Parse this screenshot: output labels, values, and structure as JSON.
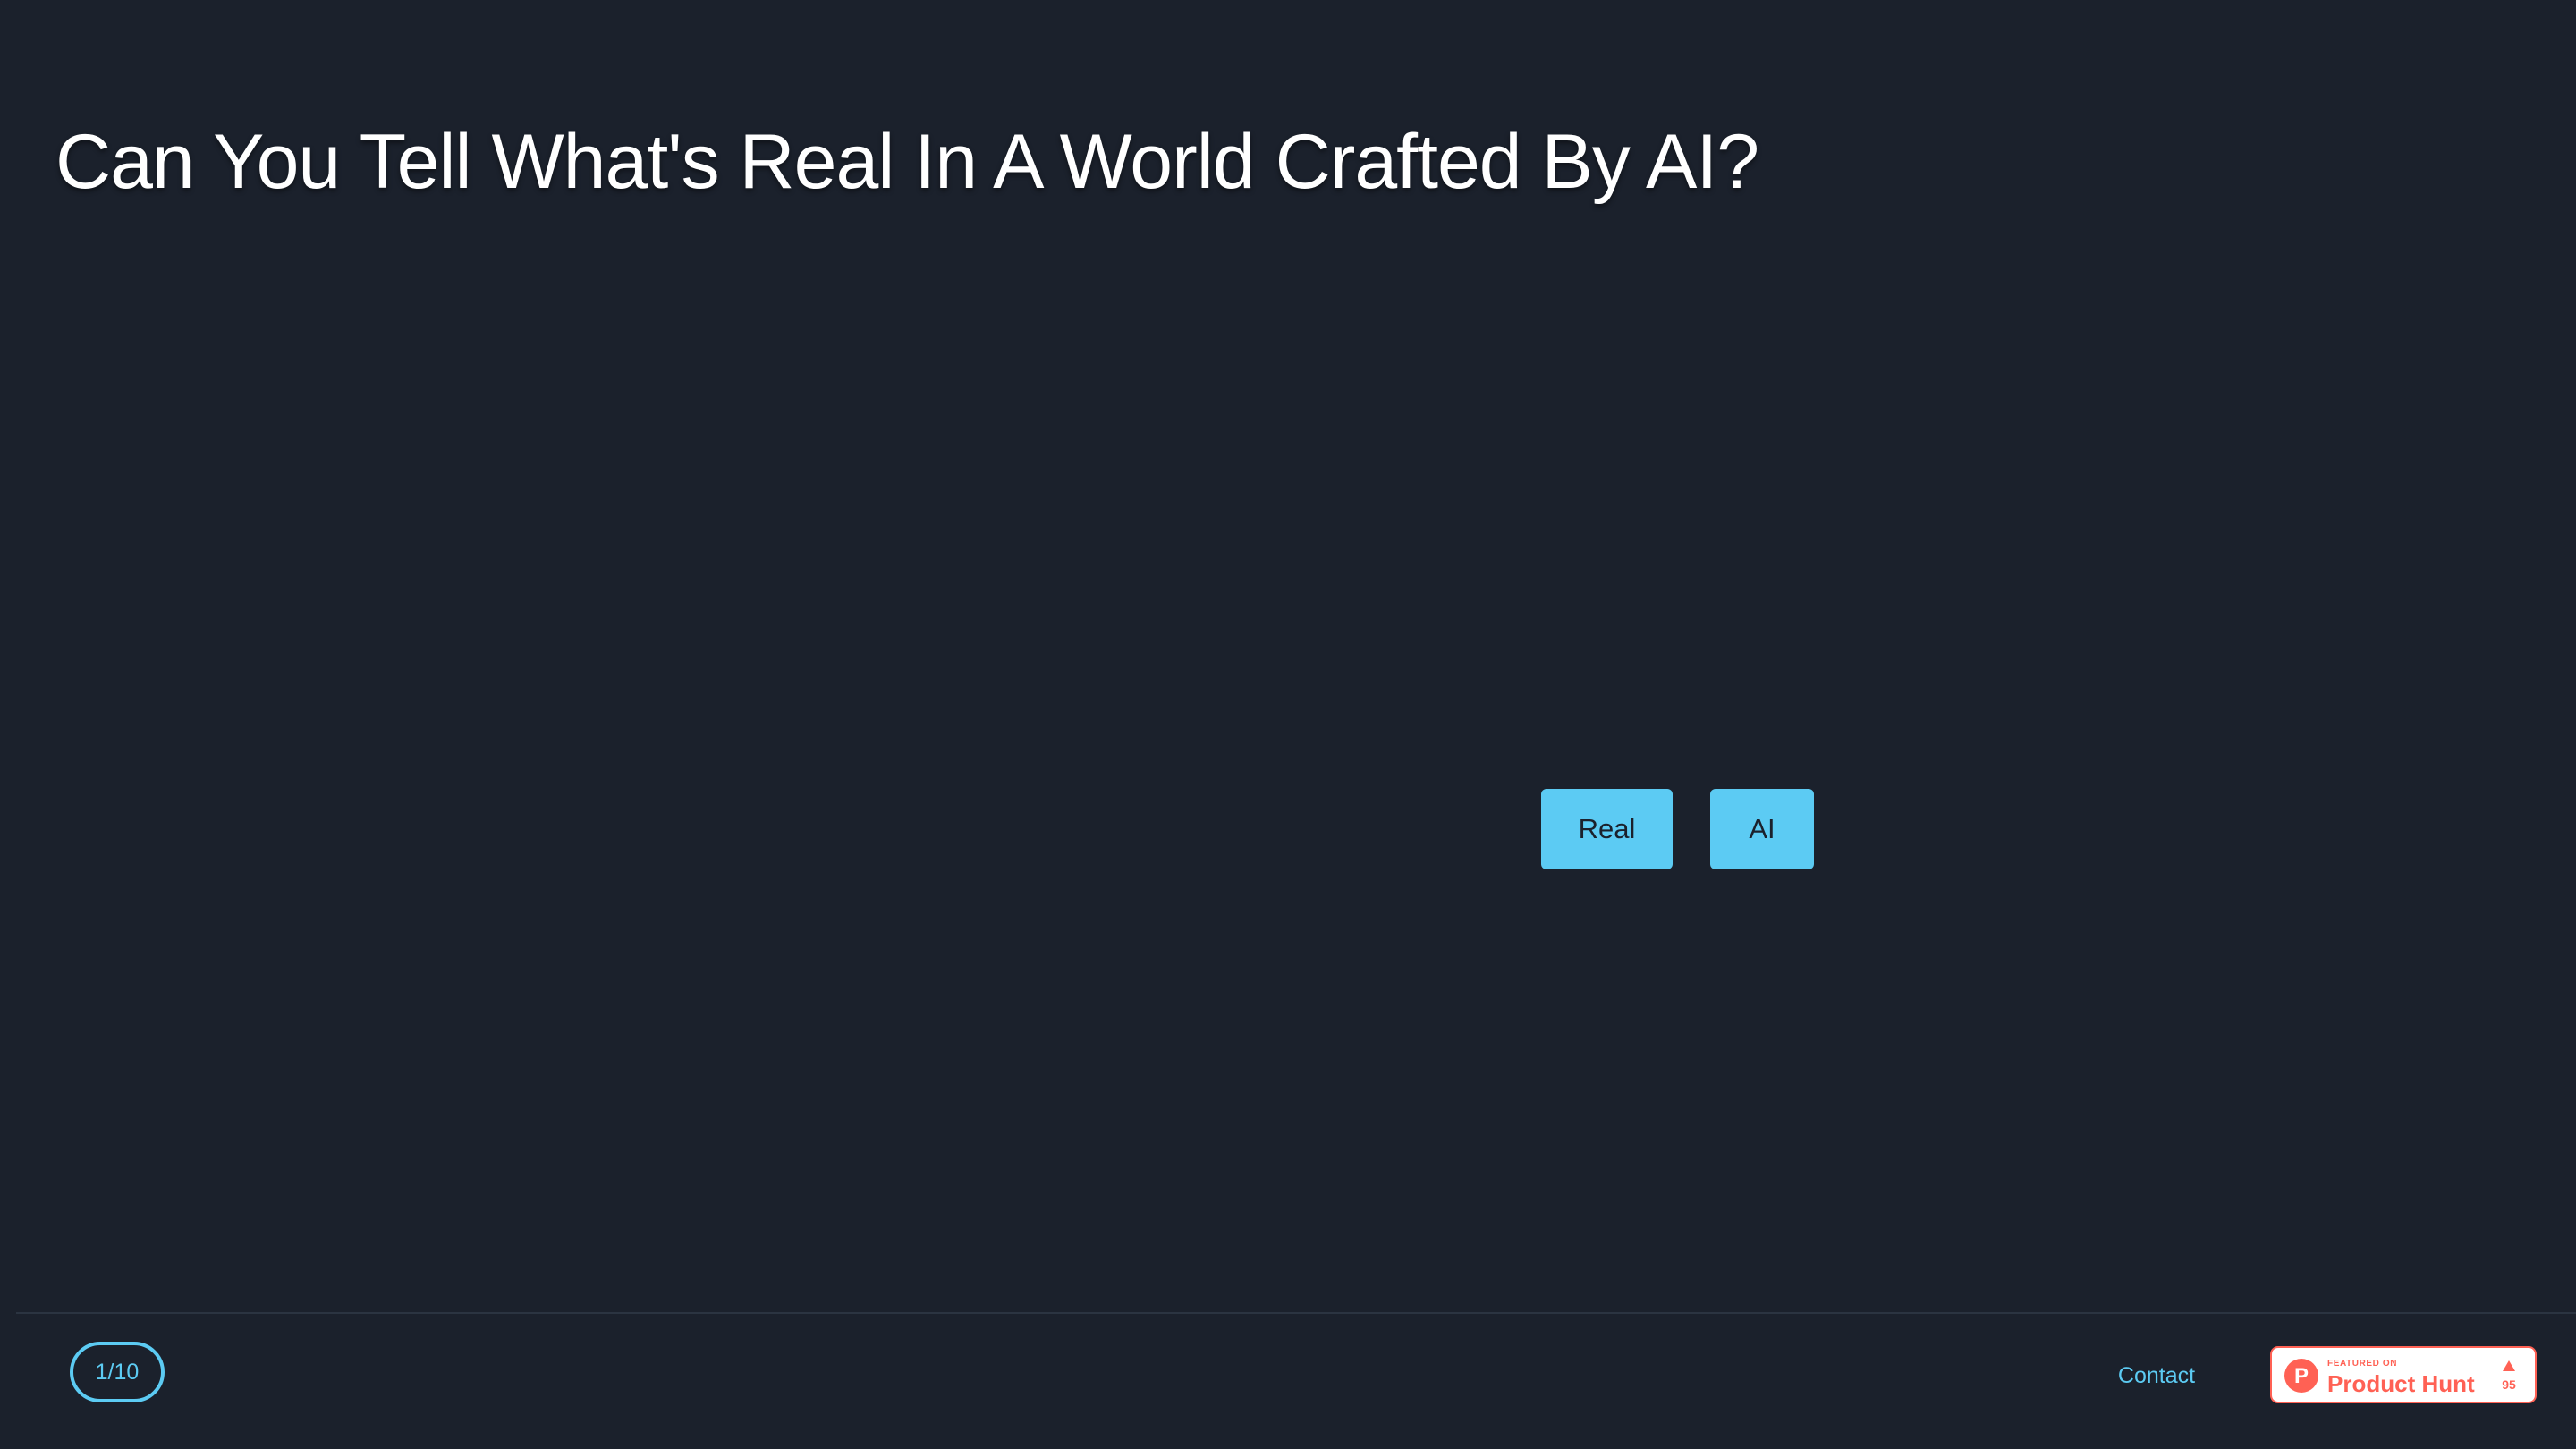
{
  "header": {
    "title": "Can You Tell What's Real In A World Crafted By AI?"
  },
  "answer_buttons": {
    "real_label": "Real",
    "ai_label": "AI"
  },
  "footer": {
    "progress_counter": "1/10",
    "contact_label": "Contact",
    "product_hunt": {
      "featured_text": "FEATURED ON",
      "name": "Product Hunt",
      "logo_letter": "P",
      "votes": "95",
      "icon": "upvote-arrow-icon"
    }
  },
  "colors": {
    "background": "#1b212c",
    "accent": "#5ccbf3",
    "title_text": "#ffffff",
    "product_hunt_brand": "#ff6154"
  }
}
